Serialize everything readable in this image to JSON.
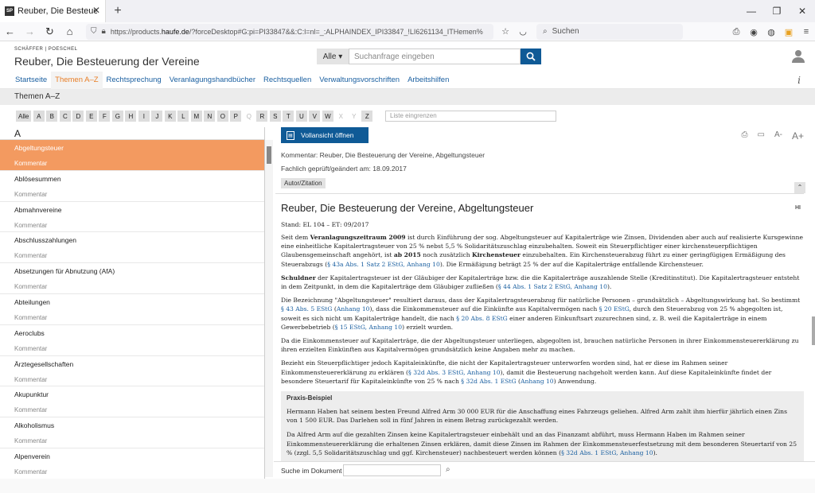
{
  "browser": {
    "tab_title": "Reuber, Die Besteuerung der Vereine",
    "favicon_text": "SP",
    "url_prefix": "https://products.",
    "url_domain": "haufe.de",
    "url_suffix": "/?forceDesktop#G:pi=PI33847&&:C:l=nl=_:ALPHAINDEX_IPI33847_!LI6261134_ITHemen%",
    "search_placeholder": "Suchen"
  },
  "header": {
    "publisher": "SCHÄFFER | POESCHEL",
    "product_title": "Reuber, Die Besteuerung der Vereine",
    "search_scope": "Alle ▾",
    "search_placeholder": "Suchanfrage eingeben"
  },
  "mainnav": [
    "Startseite",
    "Themen A–Z",
    "Rechtsprechung",
    "Veranlagungshandbücher",
    "Rechtsquellen",
    "Verwaltungsvorschriften",
    "Arbeitshilfen"
  ],
  "mainnav_active": 1,
  "subheader": "Themen A–Z",
  "letters": [
    {
      "l": "Alle",
      "on": true
    },
    {
      "l": "A",
      "on": true
    },
    {
      "l": "B",
      "on": true
    },
    {
      "l": "C",
      "on": true
    },
    {
      "l": "D",
      "on": true
    },
    {
      "l": "E",
      "on": true
    },
    {
      "l": "F",
      "on": true
    },
    {
      "l": "G",
      "on": true
    },
    {
      "l": "H",
      "on": true
    },
    {
      "l": "I",
      "on": true
    },
    {
      "l": "J",
      "on": true
    },
    {
      "l": "K",
      "on": true
    },
    {
      "l": "L",
      "on": true
    },
    {
      "l": "M",
      "on": true
    },
    {
      "l": "N",
      "on": true
    },
    {
      "l": "O",
      "on": true
    },
    {
      "l": "P",
      "on": true
    },
    {
      "l": "Q",
      "on": false
    },
    {
      "l": "R",
      "on": true
    },
    {
      "l": "S",
      "on": true
    },
    {
      "l": "T",
      "on": true
    },
    {
      "l": "U",
      "on": true
    },
    {
      "l": "V",
      "on": true
    },
    {
      "l": "W",
      "on": true
    },
    {
      "l": "X",
      "on": false
    },
    {
      "l": "Y",
      "on": false
    },
    {
      "l": "Z",
      "on": true
    }
  ],
  "filter_placeholder": "Liste eingrenzen",
  "alpha_heading": "A",
  "entries": [
    {
      "title": "Abgeltungsteuer",
      "kind": "Kommentar",
      "selected": true
    },
    {
      "title": "Ablösesummen",
      "kind": "Kommentar"
    },
    {
      "title": "Abmahnvereine",
      "kind": "Kommentar"
    },
    {
      "title": "Abschlusszahlungen",
      "kind": "Kommentar"
    },
    {
      "title": "Absetzungen für Abnutzung (AfA)",
      "kind": "Kommentar"
    },
    {
      "title": "Abteilungen",
      "kind": "Kommentar"
    },
    {
      "title": "Aeroclubs",
      "kind": "Kommentar"
    },
    {
      "title": "Ärztegesellschaften",
      "kind": "Kommentar"
    },
    {
      "title": "Akupunktur",
      "kind": "Kommentar"
    },
    {
      "title": "Alkoholismus",
      "kind": "Kommentar"
    },
    {
      "title": "Alpenverein",
      "kind": "Kommentar"
    }
  ],
  "doc": {
    "open_full": "Vollansicht öffnen",
    "meta_commentary": "Kommentar:  Reuber, Die Besteuerung der Vereine, Abgeltungsteuer",
    "meta_checked": "Fachlich geprüft/geändert am: 18.09.2017",
    "author_btn": "Autor/Zitation",
    "title": "Reuber, Die Besteuerung der Vereine, Abgeltungsteuer",
    "hi_label": "HI",
    "stand": "Stand: EL 104 – ET: 09/2017",
    "p1": [
      {
        "t": "Seit dem "
      },
      {
        "t": "Veranlagungszeitraum 2009",
        "b": true
      },
      {
        "t": " ist durch Einführung der sog. Abgeltungsteuer auf Kapitalerträge wie Zinsen, Dividenden aber auch auf realisierte Kursgewinne eine einheitliche Kapitalertragsteuer von 25 % nebst 5,5 % Solidaritätszuschlag einzubehalten. Soweit ein Steuerpflichtiger einer kirchensteuerpflichtigen Glaubensgemeinschaft angehört, ist "
      },
      {
        "t": "ab 2015",
        "b": true
      },
      {
        "t": " noch zusätzlich "
      },
      {
        "t": "Kirchensteuer",
        "b": true
      },
      {
        "t": " einzubehalten. Ein Kirchensteuerabzug führt zu einer geringfügigen Ermäßigung des Steuerabzugs ("
      },
      {
        "t": "§ 43a Abs. 1 Satz 2 EStG, Anhang 10",
        "a": true
      },
      {
        "t": "). Die Ermäßigung beträgt 25 % der auf die Kapitalerträge entfallende Kirchensteuer."
      }
    ],
    "p2": [
      {
        "t": "Schuldner",
        "b": true
      },
      {
        "t": " der Kapitalertragsteuer ist der Gläubiger der Kapitalerträge bzw. die die Kapitalerträge auszahlende Stelle (Kreditinstitut). Die Kapitalertragsteuer entsteht in dem Zeitpunkt, in dem die Kapitalerträge dem Gläubiger zufließen ("
      },
      {
        "t": "§ 44 Abs. 1 Satz 2 EStG, Anhang 10",
        "a": true
      },
      {
        "t": ")."
      }
    ],
    "p3": [
      {
        "t": "Die Bezeichnung \"Abgeltungsteuer\" resultiert daraus, dass der Kapitalertragsteuerabzug für natürliche Personen – grundsätzlich – Abgeltungswirkung hat. So bestimmt "
      },
      {
        "t": "§ 43 Abs. 5 EStG",
        "a": true
      },
      {
        "t": " ("
      },
      {
        "t": "Anhang 10",
        "a": true
      },
      {
        "t": "), dass die Einkommensteuer auf die Einkünfte aus Kapitalvermögen nach "
      },
      {
        "t": "§ 20 EStG",
        "a": true
      },
      {
        "t": ", durch den Steuerabzug von 25 % abgegolten ist, soweit es sich nicht um Kapitalerträge handelt, die nach "
      },
      {
        "t": "§ 20 Abs. 8 EStG",
        "a": true
      },
      {
        "t": " einer anderen Einkunftsart zuzurechnen sind, z. B. weil die Kapitalerträge in einem Gewerbebetrieb ("
      },
      {
        "t": "§ 15 EStG, Anhang 10",
        "a": true
      },
      {
        "t": ") erzielt wurden."
      }
    ],
    "p4": [
      {
        "t": "Da die Einkommensteuer auf Kapitalerträge, die der Abgeltungsteuer unterliegen, abgegolten ist, brauchen natürliche Personen in ihrer Einkommensteuererklärung zu ihren erzielten Einkünften aus Kapitalvermögen grundsätzlich keine Angaben mehr zu machen."
      }
    ],
    "p5": [
      {
        "t": "Bezieht ein Steuerpflichtiger jedoch Kapitaleinkünfte, die nicht der Kapitalertragsteuer unterworfen worden sind, hat er diese im Rahmen seiner Einkommensteuererklärung zu erklären ("
      },
      {
        "t": "§ 32d Abs. 3 EStG, Anhang 10",
        "a": true
      },
      {
        "t": "), damit die Besteuerung nachgeholt werden kann. Auf diese Kapitaleinkünfte findet der besondere Steuertarif für Kapitaleinkünfte von 25 % nach "
      },
      {
        "t": "§ 32d Abs. 1 EStG",
        "a": true
      },
      {
        "t": " ("
      },
      {
        "t": "Anhang 10",
        "a": true
      },
      {
        "t": ") Anwendung."
      }
    ],
    "praxis_head": "Praxis-Beispiel",
    "px1": [
      {
        "t": "Hermann Haben hat seinem besten Freund Alfred Arm 30 000 EUR für die Anschaffung eines Fahrzeugs geliehen. Alfred Arm zahlt ihm hierfür jährlich einen Zins von 1 500 EUR. Das Darlehen soll in fünf Jahren in einem Betrag zurückgezahlt werden."
      }
    ],
    "px2": [
      {
        "t": "Da Alfred Arm auf die gezahlten Zinsen keine Kapitalertragsteuer einbehält und an das Finanzamt abführt, muss Hermann Haben im Rahmen seiner Einkommensteuererklärung die erhaltenen Zinsen erklären, damit diese Zinsen im Rahmen der Einkommensteuerfestsetzung mit dem besonderen Steuertarif von 25 % (zzgl. 5,5 Solidaritätszuschlag und ggf. Kirchensteuer) nachbesteuert werden können ("
      },
      {
        "t": "§ 32d Abs. 1 EStG, Anhang 10",
        "a": true
      },
      {
        "t": ")."
      }
    ]
  },
  "bottom": {
    "search_label": "Suche im Dokument"
  }
}
